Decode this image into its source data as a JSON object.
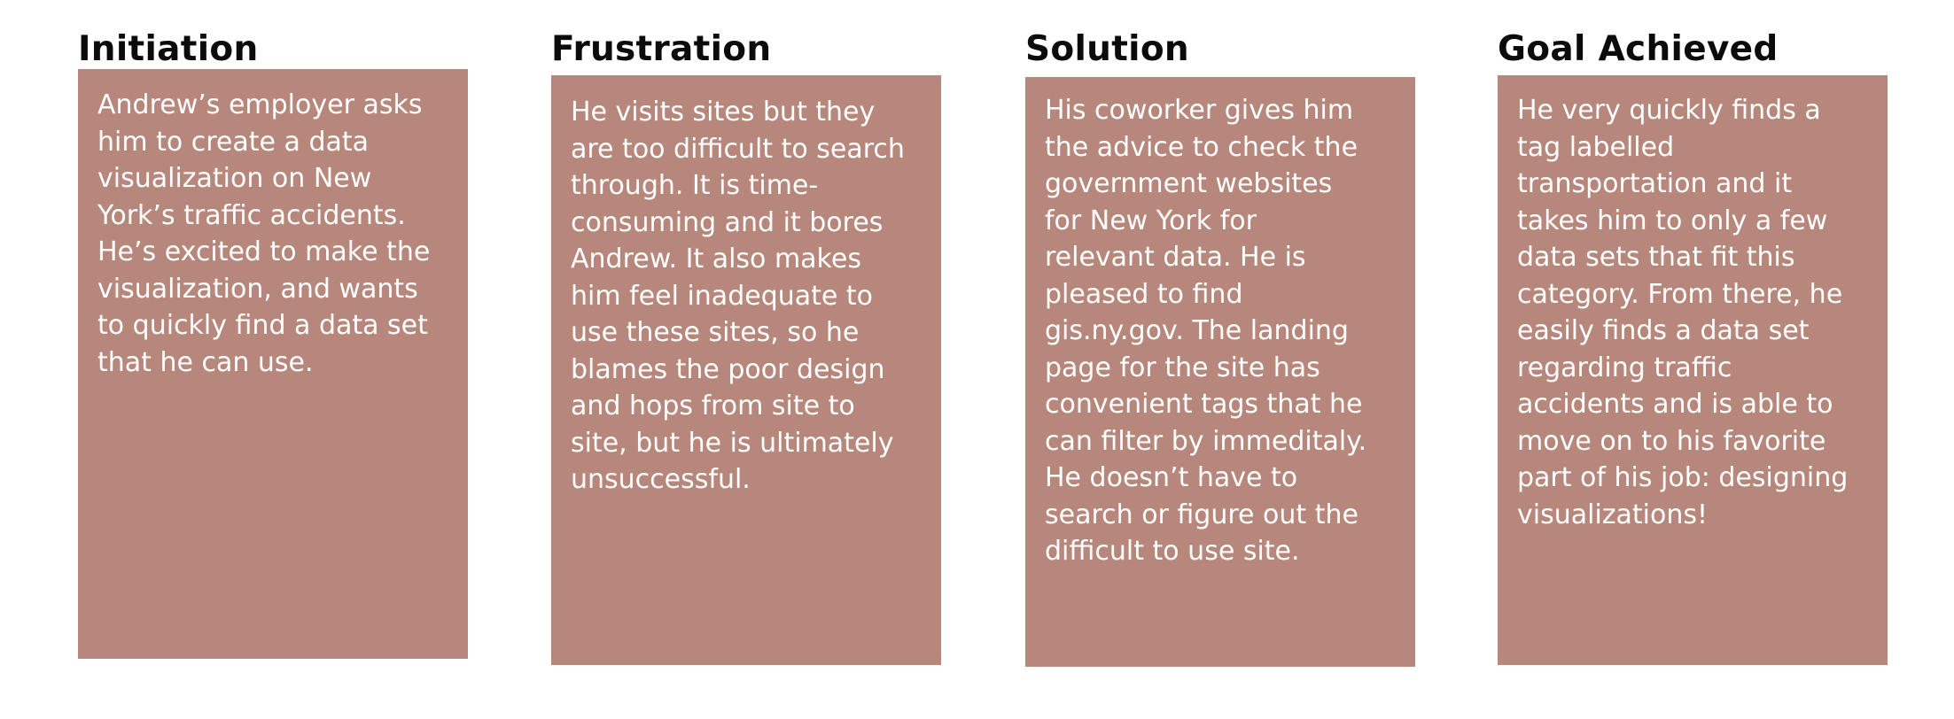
{
  "stages": [
    {
      "title": "Initiation",
      "text": "Andrew’s employer asks\nhim to create a data\nvisualization on New\nYork’s traffic accidents.\nHe’s excited to make the\nvisualization, and wants\nto quickly find a data set\nthat he can use."
    },
    {
      "title": "Frustration",
      "text": "He visits sites but they\nare too difficult to search\nthrough. It is time-\nconsuming and it bores\nAndrew. It also makes\nhim feel inadequate to\nuse these sites, so he\nblames the poor design\nand hops from site to\nsite, but he is ultimately\nunsuccessful."
    },
    {
      "title": "Solution",
      "text": "His coworker gives him\nthe advice to check the\ngovernment websites\nfor New York for\nrelevant data. He is\npleased to find\ngis.ny.gov. The landing\npage for the site has\nconvenient tags that he\ncan filter by immeditaly.\nHe doesn’t have to\nsearch or figure out the\ndifficult to use site."
    },
    {
      "title": "Goal Achieved",
      "text": "He very quickly finds a\ntag labelled\ntransportation and it\ntakes him to only a few\ndata sets that fit this\ncategory. From there, he\neasily finds a data set\nregarding traffic\naccidents and is able to\nmove on to his favorite\npart of his job: designing\nvisualizations!"
    }
  ],
  "colors": {
    "card_background": "#b7877c",
    "card_text": "#ffffff",
    "title_text": "#0b0b0b",
    "page_background": "#ffffff"
  }
}
